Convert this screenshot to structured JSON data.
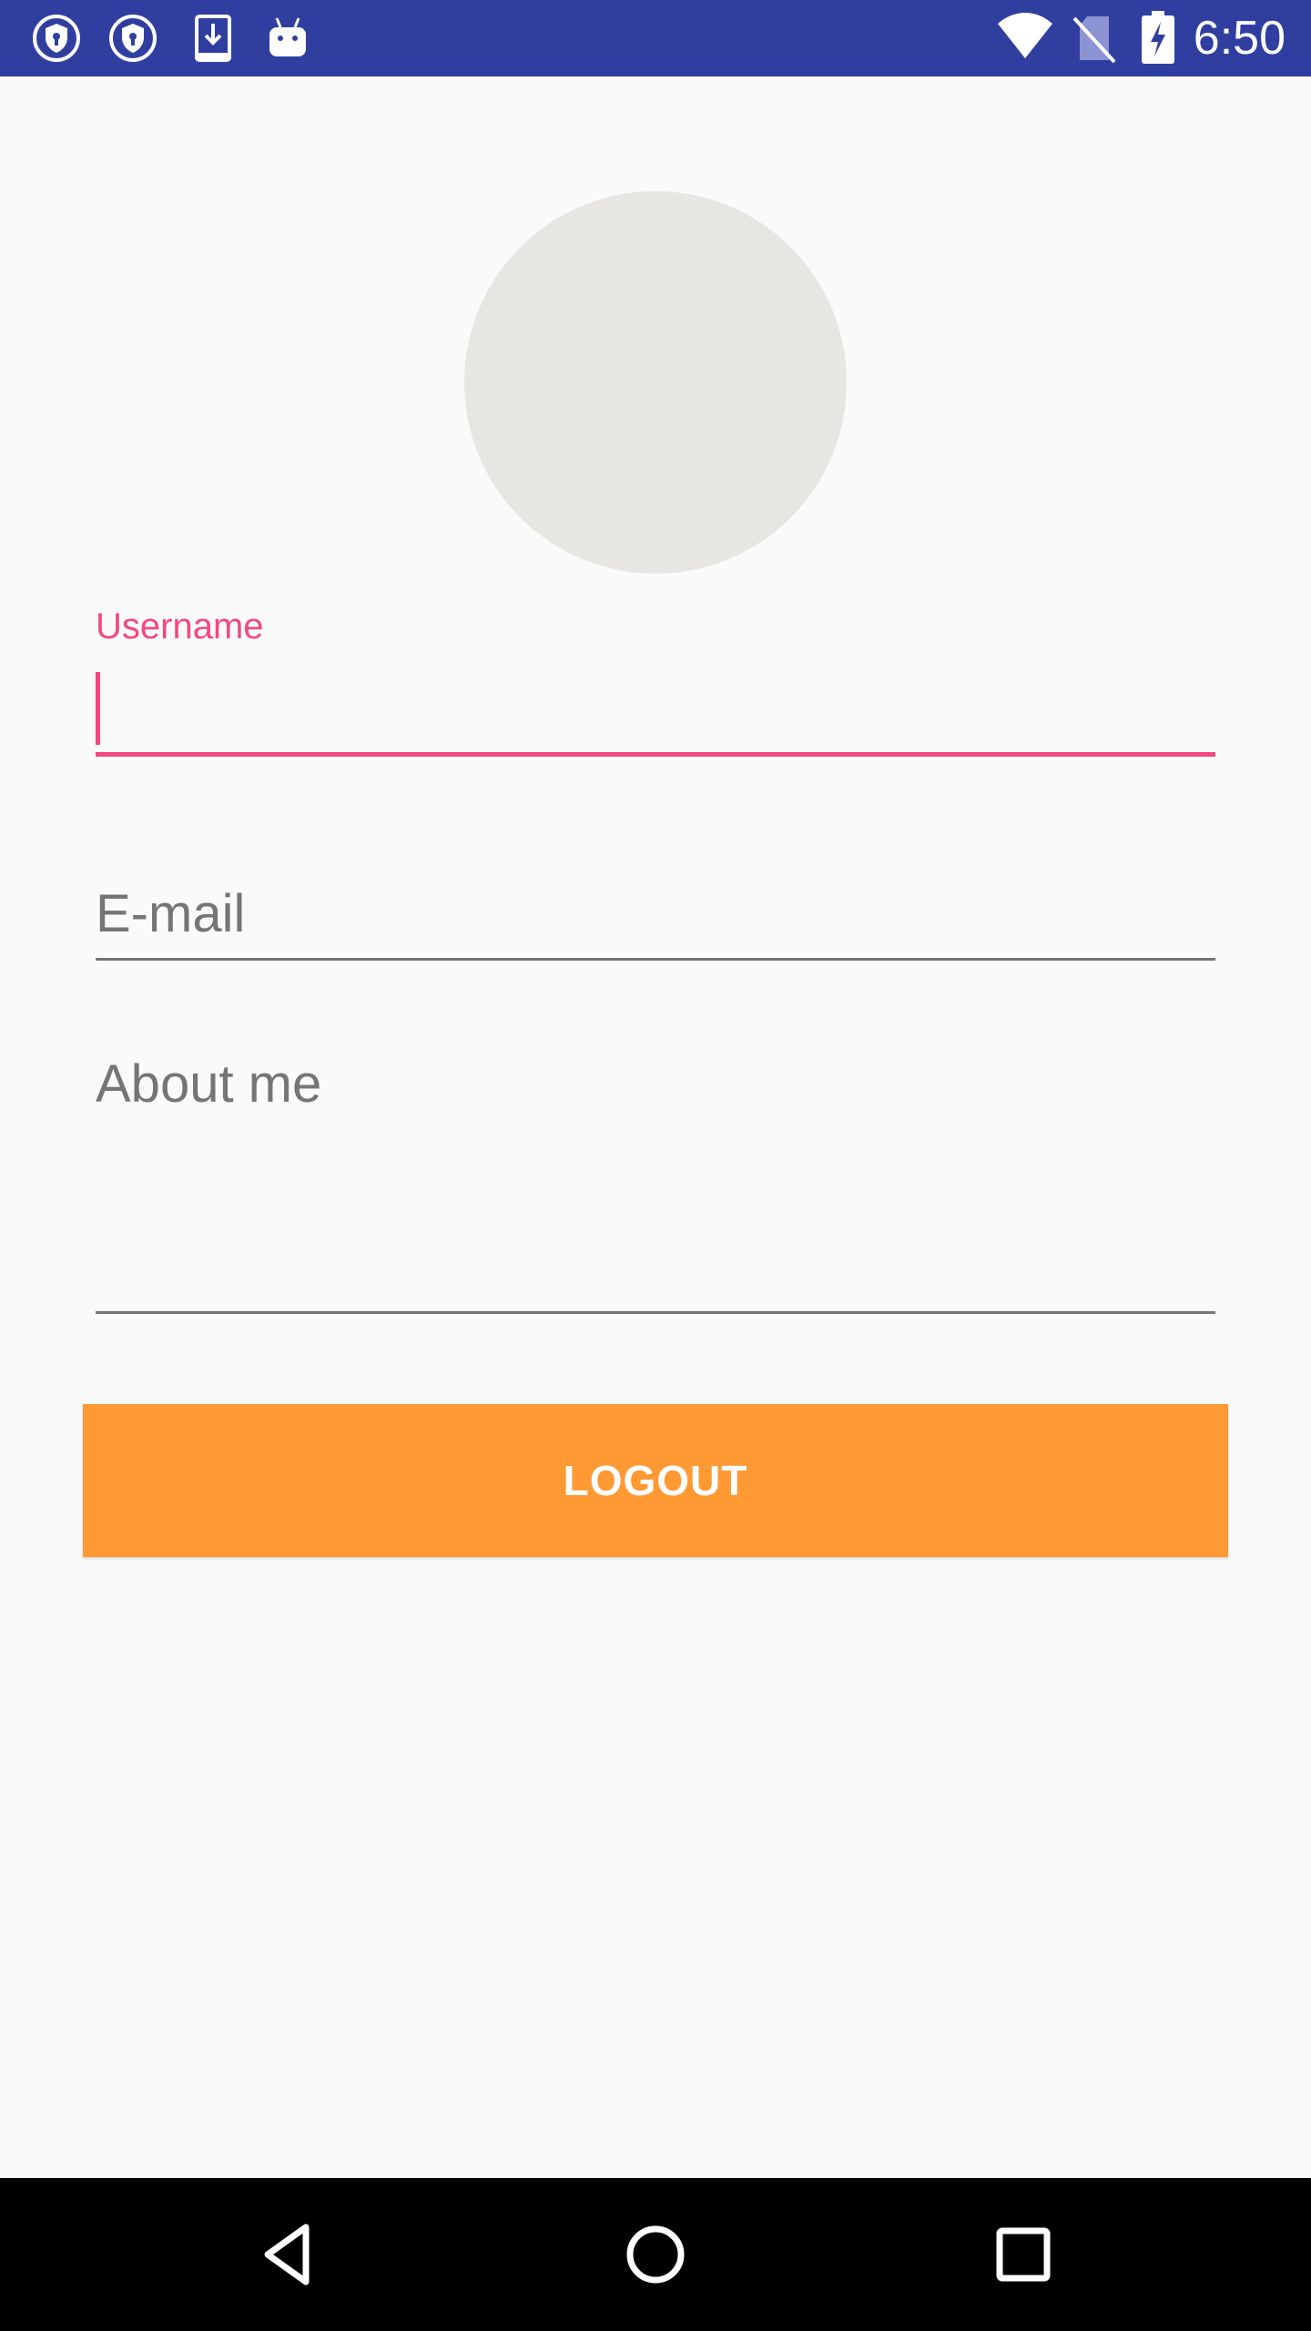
{
  "status_bar": {
    "time": "6:50",
    "left_icons": [
      "vpn-shield-icon",
      "vpn-shield-icon",
      "download-icon",
      "android-icon"
    ],
    "right_icons": [
      "wifi-icon",
      "no-sim-icon",
      "battery-charging-icon"
    ],
    "background_color": "#303f9f"
  },
  "profile": {
    "avatar_color": "#e7e6e3"
  },
  "form": {
    "username_label": "Username",
    "username_value": "",
    "email_hint": "E-mail",
    "about_hint": "About me",
    "focus_color": "#f2497f"
  },
  "actions": {
    "logout_label": "LOGOUT",
    "logout_color": "#ff9934"
  },
  "nav_bar": {
    "buttons": [
      "back-icon",
      "home-icon",
      "recents-icon"
    ]
  }
}
